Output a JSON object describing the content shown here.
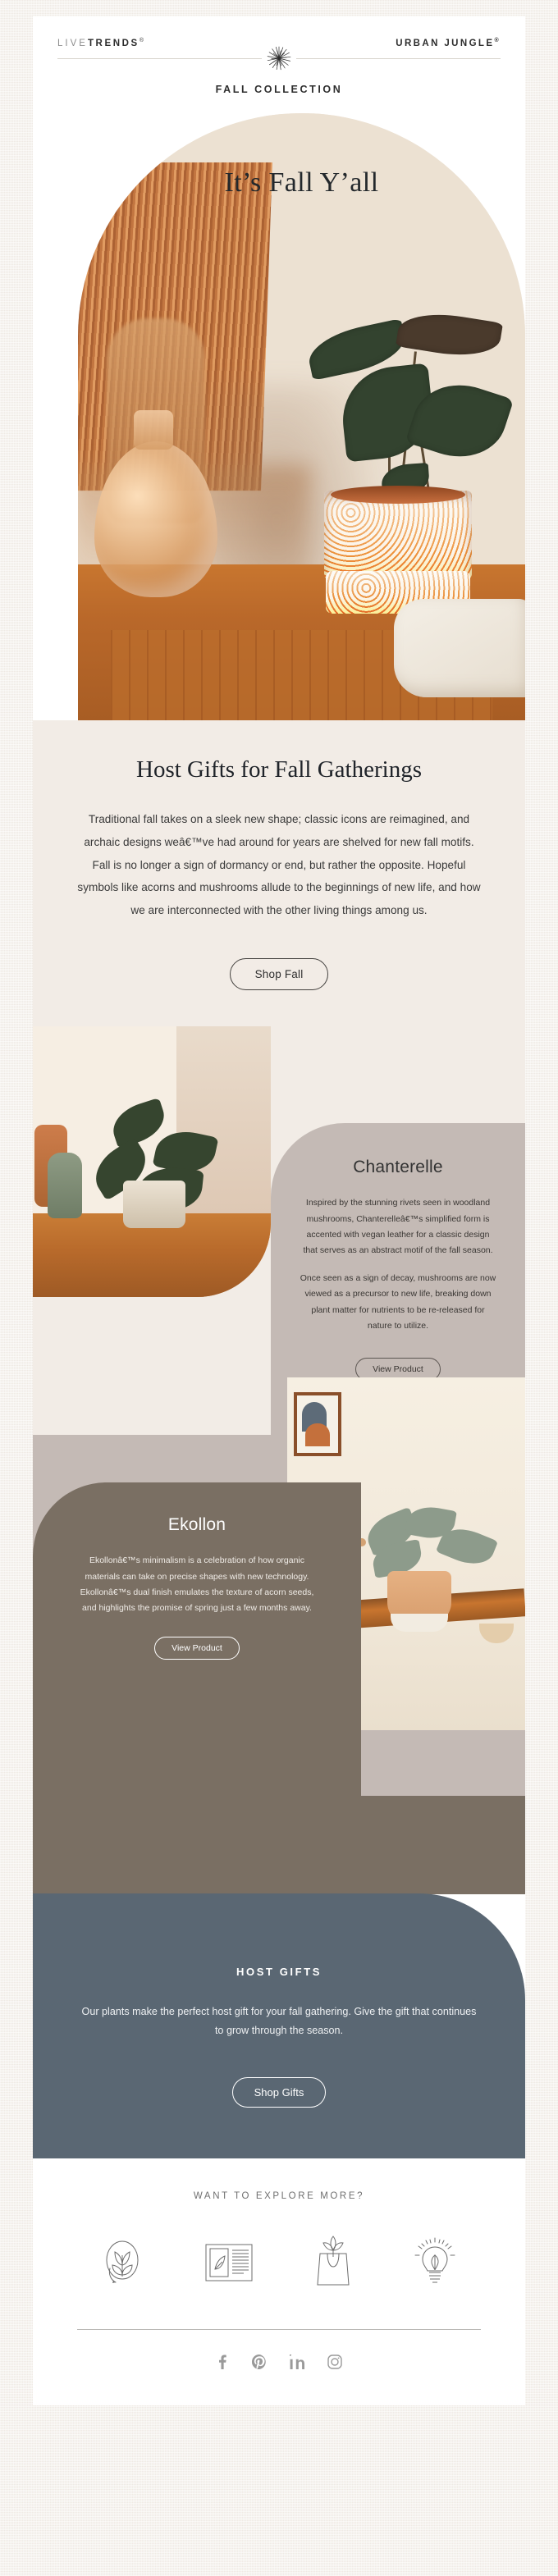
{
  "header": {
    "brand_left_thin": "LIVE",
    "brand_left_bold": "TRENDS",
    "brand_left_reg": "®",
    "brand_right": "URBAN JUNGLE",
    "brand_right_reg": "®",
    "brandmark_icon": "dandelion-burst-icon",
    "kicker": "FALL COLLECTION"
  },
  "hero": {
    "title": "It’s Fall Y’all",
    "image_alt": "speckled ceramic planter with alocasia on wood credenza"
  },
  "intro": {
    "heading": "Host Gifts for Fall Gatherings",
    "body": "Traditional fall takes on a sleek new shape; classic icons are reimagined, and archaic designs weâ€™ve had around for years are shelved for new fall motifs. Fall is no longer a sign of dormancy or end, but rather the opposite. Hopeful symbols like acorns and mushrooms allude to the beginnings of new life, and how we are interconnected with the other living things among us.",
    "cta": "Shop Fall"
  },
  "products": [
    {
      "name": "Chanterelle",
      "paragraph1": "Inspired by the stunning rivets seen in woodland mushrooms, Chanterelleâ€™s simplified form is accented with vegan leather for a classic design that serves as an abstract motif of the fall season.",
      "paragraph2": "Once seen as a sign of decay, mushrooms are now viewed as a precursor to new life, breaking down plant matter for nutrients to be re-released for nature to utilize.",
      "cta": "View Product"
    },
    {
      "name": "Ekollon",
      "paragraph1": "Ekollonâ€™s minimalism is a celebration of how organic materials can take on precise shapes with new technology. Ekollonâ€™s dual finish emulates the texture of acorn seeds, and highlights the promise of spring just a few months away.",
      "cta": "View Product"
    }
  ],
  "gifts": {
    "heading": "HOST GIFTS",
    "body": "Our plants make the perfect host gift for your fall gathering. Give the gift that continues to grow through the season.",
    "cta": "Shop Gifts"
  },
  "footer": {
    "explore_label": "WANT TO EXPLORE MORE?",
    "explore_icons": [
      {
        "icon": "plant-care-leaf-icon",
        "label": "Plant Care"
      },
      {
        "icon": "blog-article-icon",
        "label": "Blog"
      },
      {
        "icon": "gift-bag-plant-icon",
        "label": "Gifting"
      },
      {
        "icon": "lightbulb-leaf-icon",
        "label": "Ideas"
      }
    ],
    "social": [
      {
        "icon": "facebook-icon",
        "label": "Facebook"
      },
      {
        "icon": "pinterest-icon",
        "label": "Pinterest"
      },
      {
        "icon": "linkedin-icon",
        "label": "LinkedIn"
      },
      {
        "icon": "instagram-icon",
        "label": "Instagram"
      }
    ]
  },
  "colors": {
    "page_bg": "#efeae4",
    "panel_bg": "#f2ece6",
    "chanterelle_card": "#c4bab5",
    "ekollon_card": "#7a6f63",
    "gifts_card": "#5a6773",
    "ink": "#2d2d2d"
  }
}
